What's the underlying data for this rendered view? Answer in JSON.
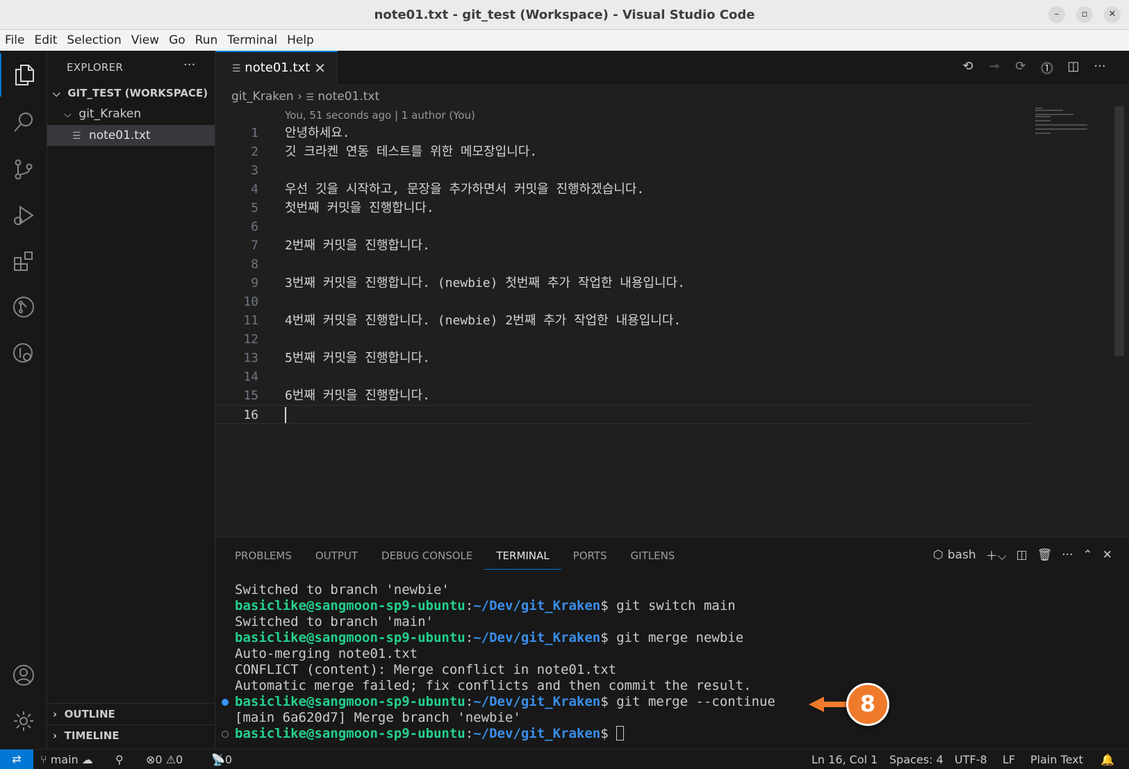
{
  "window": {
    "title": "note01.txt - git_test (Workspace) - Visual Studio Code"
  },
  "menu": [
    "File",
    "Edit",
    "Selection",
    "View",
    "Go",
    "Run",
    "Terminal",
    "Help"
  ],
  "explorer": {
    "title": "EXPLORER",
    "workspace": "GIT_TEST (WORKSPACE)",
    "folder": "git_Kraken",
    "file": "note01.txt",
    "outline": "OUTLINE",
    "timeline": "TIMELINE"
  },
  "editor": {
    "tab": "note01.txt",
    "breadcrumb_folder": "git_Kraken",
    "breadcrumb_file": "note01.txt",
    "codelens": "You, 51 seconds ago | 1 author (You)",
    "lines": [
      {
        "n": "1",
        "text": "안녕하세요."
      },
      {
        "n": "2",
        "text": "깃 크라켄 연동 테스트를 위한 메모장입니다."
      },
      {
        "n": "3",
        "text": ""
      },
      {
        "n": "4",
        "text": "우선 깃을 시작하고, 문장을 추가하면서 커밋을 진행하겠습니다."
      },
      {
        "n": "5",
        "text": "첫번째 커밋을 진행합니다."
      },
      {
        "n": "6",
        "text": ""
      },
      {
        "n": "7",
        "text": "2번째 커밋을 진행합니다."
      },
      {
        "n": "8",
        "text": ""
      },
      {
        "n": "9",
        "text": "3번째 커밋을 진행합니다. (newbie) 첫번째 추가 작업한 내용입니다."
      },
      {
        "n": "10",
        "text": ""
      },
      {
        "n": "11",
        "text": "4번째 커밋을 진행합니다. (newbie) 2번째 추가 작업한 내용입니다."
      },
      {
        "n": "12",
        "text": ""
      },
      {
        "n": "13",
        "text": "5번째 커밋을 진행합니다."
      },
      {
        "n": "14",
        "text": ""
      },
      {
        "n": "15",
        "text": "6번째 커밋을 진행합니다."
      },
      {
        "n": "16",
        "text": ""
      }
    ]
  },
  "panel": {
    "tabs": [
      "PROBLEMS",
      "OUTPUT",
      "DEBUG CONSOLE",
      "TERMINAL",
      "PORTS",
      "GITLENS"
    ],
    "active_tab": "TERMINAL",
    "shell": "bash",
    "terminal": [
      {
        "type": "out",
        "text": "Switched to branch 'newbie'"
      },
      {
        "type": "prompt",
        "user": "basiclike@sangmoon-sp9-ubuntu",
        "path": "~/Dev/git_Kraken",
        "cmd": "git switch main"
      },
      {
        "type": "out",
        "text": "Switched to branch 'main'"
      },
      {
        "type": "prompt",
        "user": "basiclike@sangmoon-sp9-ubuntu",
        "path": "~/Dev/git_Kraken",
        "cmd": "git merge newbie"
      },
      {
        "type": "out",
        "text": "Auto-merging note01.txt"
      },
      {
        "type": "out",
        "text": "CONFLICT (content): Merge conflict in note01.txt"
      },
      {
        "type": "out",
        "text": "Automatic merge failed; fix conflicts and then commit the result."
      },
      {
        "type": "prompt",
        "user": "basiclike@sangmoon-sp9-ubuntu",
        "path": "~/Dev/git_Kraken",
        "cmd": "git merge --continue",
        "deco": "blue"
      },
      {
        "type": "out",
        "text": "[main 6a620d7] Merge branch 'newbie'"
      },
      {
        "type": "prompt",
        "user": "basiclike@sangmoon-sp9-ubuntu",
        "path": "~/Dev/git_Kraken",
        "cmd": "",
        "deco": "hollow",
        "cursor": true
      }
    ]
  },
  "annotation": {
    "number": "8",
    "color": "#f07a2b"
  },
  "status": {
    "branch": "main",
    "errors": "0",
    "warnings": "0",
    "ports": "0",
    "position": "Ln 16, Col 1",
    "spaces": "Spaces: 4",
    "encoding": "UTF-8",
    "eol": "LF",
    "language": "Plain Text"
  },
  "colors": {
    "accent": "#0078d4",
    "prompt_user": "#23d18b",
    "prompt_path": "#3b8eea"
  }
}
